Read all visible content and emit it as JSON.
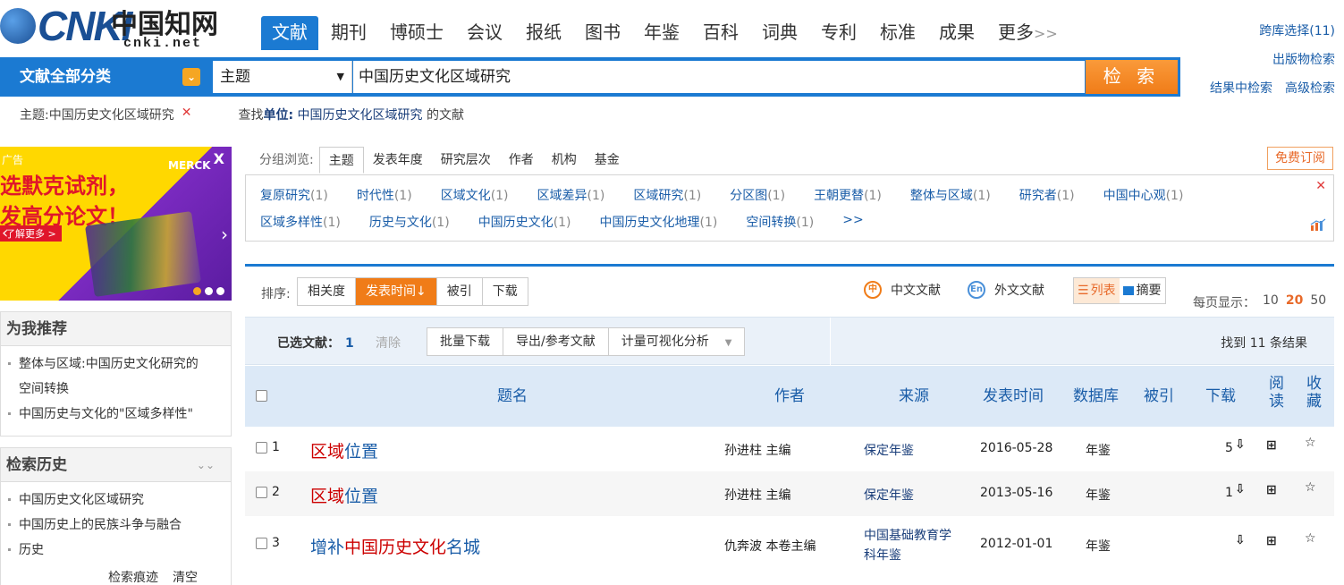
{
  "logo": {
    "brand": "CNKI",
    "zh": "中国知网",
    "domain": "cnki.net"
  },
  "topnav": [
    "文献",
    "期刊",
    "博硕士",
    "会议",
    "报纸",
    "图书",
    "年鉴",
    "百科",
    "词典",
    "专利",
    "标准",
    "成果",
    "更多"
  ],
  "topnav_more_arrow": ">>",
  "right_links": {
    "cross_db": "跨库选择(11)",
    "pub_search": "出版物检索",
    "in_result": "结果中检索",
    "advanced": "高级检索"
  },
  "search": {
    "category": "文献全部分类",
    "field": "主题",
    "query": "中国历史文化区域研究",
    "button": "检 索"
  },
  "crumbs": {
    "topic": "主题:中国历史文化区域研究",
    "find_prefix": "查找",
    "find_label": "单位:",
    "find_kw": "中国历史文化区域研究",
    "find_suffix": "的文献"
  },
  "ad": {
    "tag": "广告",
    "brand": "MERCK",
    "line1": "选默克试剂，",
    "line2": "发高分论文！",
    "more": "了解更多 >"
  },
  "recommend": {
    "title": "为我推荐",
    "items": [
      "整体与区域:中国历史文化研究的",
      "空间转换",
      "中国历史与文化的\"区域多样性\""
    ]
  },
  "history": {
    "title": "检索历史",
    "items": [
      "中国历史文化区域研究",
      "中国历史上的民族斗争与融合",
      "历史"
    ],
    "trace": "检索痕迹",
    "clear": "清空"
  },
  "group_browse": {
    "label": "分组浏览:",
    "tabs": [
      "主题",
      "发表年度",
      "研究层次",
      "作者",
      "机构",
      "基金"
    ],
    "subscribe": "免费订阅",
    "row1": [
      {
        "name": "复原研究",
        "count": "(1)"
      },
      {
        "name": "时代性",
        "count": "(1)"
      },
      {
        "name": "区域文化",
        "count": "(1)"
      },
      {
        "name": "区域差异",
        "count": "(1)"
      },
      {
        "name": "区域研究",
        "count": "(1)"
      },
      {
        "name": "分区图",
        "count": "(1)"
      },
      {
        "name": "王朝更替",
        "count": "(1)"
      },
      {
        "name": "整体与区域",
        "count": "(1)"
      },
      {
        "name": "研究者",
        "count": "(1)"
      },
      {
        "name": "中国中心观",
        "count": "(1)"
      }
    ],
    "row2": [
      {
        "name": "区域多样性",
        "count": "(1)"
      },
      {
        "name": "历史与文化",
        "count": "(1)"
      },
      {
        "name": "中国历史文化",
        "count": "(1)"
      },
      {
        "name": "中国历史文化地理",
        "count": "(1)"
      },
      {
        "name": "空间转换",
        "count": "(1)"
      }
    ],
    "more": ">>"
  },
  "sort": {
    "label": "排序:",
    "options": [
      "相关度",
      "发表时间",
      "被引",
      "下载"
    ],
    "active_suffix": "↓"
  },
  "lang": {
    "zh": "中文文献",
    "en": "外文文献",
    "zh_icon": "中",
    "en_icon": "En"
  },
  "view": {
    "list": "列表",
    "abstract": "摘要"
  },
  "perpage": {
    "label": "每页显示：",
    "options": [
      "10",
      "20",
      "50"
    ]
  },
  "selection": {
    "label": "已选文献：",
    "count": "1",
    "clear": "清除",
    "tools": [
      "批量下载",
      "导出/参考文献",
      "计量可视化分析"
    ],
    "found": "找到 11 条结果"
  },
  "columns": {
    "title": "题名",
    "author": "作者",
    "source": "来源",
    "date": "发表时间",
    "db": "数据库",
    "cited": "被引",
    "download": "下载",
    "read": "阅读",
    "fav": "收藏"
  },
  "rows": [
    {
      "no": "1",
      "title_hl": "区域",
      "title_rest": "位置",
      "author": "孙进柱 主编",
      "source": "保定年鉴",
      "date": "2016-05-28",
      "db": "年鉴",
      "downloads": "5"
    },
    {
      "no": "2",
      "title_hl": "区域",
      "title_rest": "位置",
      "author": "孙进柱 主编",
      "source": "保定年鉴",
      "date": "2013-05-16",
      "db": "年鉴",
      "downloads": "1"
    },
    {
      "no": "3",
      "title_pre": "增补",
      "title_hl": "中国历史文化",
      "title_rest": "名城",
      "author": "仇奔波 本卷主编",
      "source_l1": "中国基础教育学",
      "source_l2": "科年鉴",
      "date": "2012-01-01",
      "db": "年鉴",
      "downloads": ""
    }
  ]
}
